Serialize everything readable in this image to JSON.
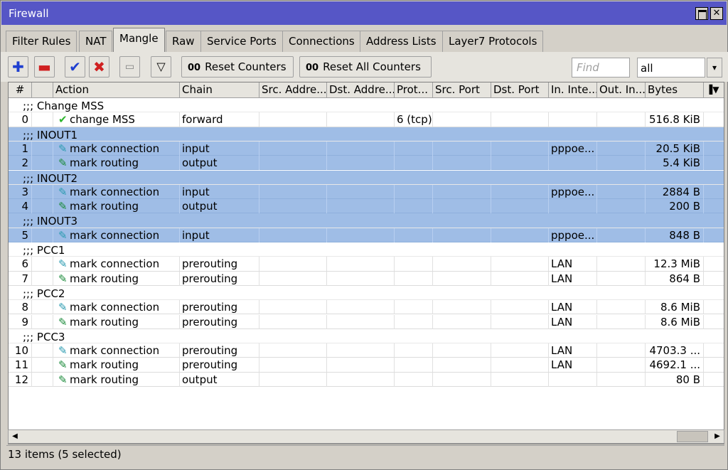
{
  "window": {
    "title": "Firewall"
  },
  "tabs": [
    "Filter Rules",
    "NAT",
    "Mangle",
    "Raw",
    "Service Ports",
    "Connections",
    "Address Lists",
    "Layer7 Protocols"
  ],
  "active_tab": "Mangle",
  "toolbar": {
    "reset_counters": "Reset Counters",
    "reset_all_counters": "Reset All Counters",
    "oo": "00",
    "find_placeholder": "Find",
    "filter_value": "all"
  },
  "columns": [
    "#",
    "",
    "Action",
    "Chain",
    "Src. Addre...",
    "Dst. Addre...",
    "Prot...",
    "Src. Port",
    "Dst. Port",
    "In. Inte...",
    "Out. In...",
    "Bytes"
  ],
  "rows": [
    {
      "type": "comment",
      "text": ";;; Change MSS",
      "selected": false
    },
    {
      "type": "rule",
      "num": "0",
      "icon": "check",
      "action": "change MSS",
      "chain": "forward",
      "proto": "6 (tcp)",
      "in": "",
      "bytes": "516.8 KiB",
      "selected": false
    },
    {
      "type": "comment",
      "text": ";;; INOUT1",
      "selected": true
    },
    {
      "type": "rule",
      "num": "1",
      "icon": "mark-connection",
      "action": "mark connection",
      "chain": "input",
      "proto": "",
      "in": "pppoe...",
      "bytes": "20.5 KiB",
      "selected": true
    },
    {
      "type": "rule",
      "num": "2",
      "icon": "mark-routing",
      "action": "mark routing",
      "chain": "output",
      "proto": "",
      "in": "",
      "bytes": "5.4 KiB",
      "selected": true
    },
    {
      "type": "comment",
      "text": ";;; INOUT2",
      "selected": true
    },
    {
      "type": "rule",
      "num": "3",
      "icon": "mark-connection",
      "action": "mark connection",
      "chain": "input",
      "proto": "",
      "in": "pppoe...",
      "bytes": "2884 B",
      "selected": true
    },
    {
      "type": "rule",
      "num": "4",
      "icon": "mark-routing",
      "action": "mark routing",
      "chain": "output",
      "proto": "",
      "in": "",
      "bytes": "200 B",
      "selected": true
    },
    {
      "type": "comment",
      "text": ";;; INOUT3",
      "selected": true
    },
    {
      "type": "rule",
      "num": "5",
      "icon": "mark-connection",
      "action": "mark connection",
      "chain": "input",
      "proto": "",
      "in": "pppoe...",
      "bytes": "848 B",
      "selected": true
    },
    {
      "type": "comment",
      "text": ";;; PCC1",
      "selected": false
    },
    {
      "type": "rule",
      "num": "6",
      "icon": "mark-connection",
      "action": "mark connection",
      "chain": "prerouting",
      "proto": "",
      "in": "LAN",
      "bytes": "12.3 MiB",
      "selected": false
    },
    {
      "type": "rule",
      "num": "7",
      "icon": "mark-routing",
      "action": "mark routing",
      "chain": "prerouting",
      "proto": "",
      "in": "LAN",
      "bytes": "864 B",
      "selected": false
    },
    {
      "type": "comment",
      "text": ";;; PCC2",
      "selected": false
    },
    {
      "type": "rule",
      "num": "8",
      "icon": "mark-connection",
      "action": "mark connection",
      "chain": "prerouting",
      "proto": "",
      "in": "LAN",
      "bytes": "8.6 MiB",
      "selected": false
    },
    {
      "type": "rule",
      "num": "9",
      "icon": "mark-routing",
      "action": "mark routing",
      "chain": "prerouting",
      "proto": "",
      "in": "LAN",
      "bytes": "8.6 MiB",
      "selected": false
    },
    {
      "type": "comment",
      "text": ";;; PCC3",
      "selected": false
    },
    {
      "type": "rule",
      "num": "10",
      "icon": "mark-connection",
      "action": "mark connection",
      "chain": "prerouting",
      "proto": "",
      "in": "LAN",
      "bytes": "4703.3 ...",
      "selected": false
    },
    {
      "type": "rule",
      "num": "11",
      "icon": "mark-routing",
      "action": "mark routing",
      "chain": "prerouting",
      "proto": "",
      "in": "LAN",
      "bytes": "4692.1 ...",
      "selected": false
    },
    {
      "type": "rule",
      "num": "12",
      "icon": "mark-routing",
      "action": "mark routing",
      "chain": "output",
      "proto": "",
      "in": "",
      "bytes": "80 B",
      "selected": false
    }
  ],
  "status": "13 items (5 selected)",
  "colors": {
    "title_bg": "#5656c6",
    "selected_row": "#9fbde6",
    "window_bg": "#d4d0c8"
  }
}
